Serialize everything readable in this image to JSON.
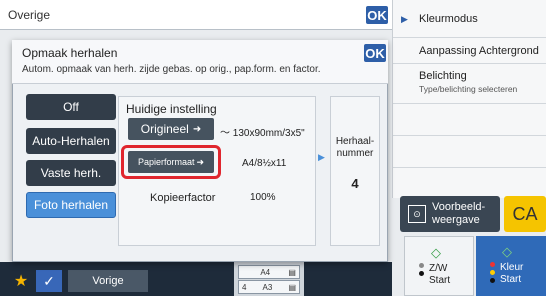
{
  "top_bar": {
    "title": "Overige",
    "ok": "OK"
  },
  "right_panel": {
    "items": [
      {
        "label": "Kleurmodus"
      },
      {
        "label": "Aanpassing Achtergrond"
      },
      {
        "label": "Belichting",
        "sub": "Type/belichting selecteren"
      }
    ]
  },
  "dialog": {
    "title": "Opmaak herhalen",
    "subtitle": "Autom. opmaak van herh. zijde gebas. op orig., pap.form. en factor.",
    "ok": "OK",
    "options": [
      {
        "label": "Off",
        "selected": false
      },
      {
        "label": "Auto-Herhalen",
        "selected": false
      },
      {
        "label": "Vaste herh.",
        "selected": false
      },
      {
        "label": "Foto herhalen",
        "selected": true
      }
    ],
    "current_settings": {
      "title": "Huidige instelling",
      "original_button": "Origineel",
      "original_value": "～ 130x90mm/3x5\"",
      "paper_button": "Papierformaat",
      "paper_value": "A4/8½x11",
      "factor_label": "Kopieerfactor",
      "factor_value": "100%"
    },
    "repeat": {
      "label_line1": "Herhaal-",
      "label_line2": "nummer",
      "value": "4"
    }
  },
  "bottom": {
    "prev_label": "Vorige",
    "thumbs": [
      {
        "num": "",
        "size": "A4"
      },
      {
        "num": "4",
        "size": "A3"
      }
    ]
  },
  "actions": {
    "preview_line1": "Voorbeeld-",
    "preview_line2": "weergave",
    "ca": "CA",
    "bw_start_line1": "Z/W",
    "bw_start_line2": "Start",
    "color_start_line1": "Kleur",
    "color_start_line2": "Start"
  },
  "colors": {
    "accent": "#2e5fa8",
    "selected": "#4a90d9",
    "highlight": "#e0262e",
    "ca": "#f5c400"
  }
}
